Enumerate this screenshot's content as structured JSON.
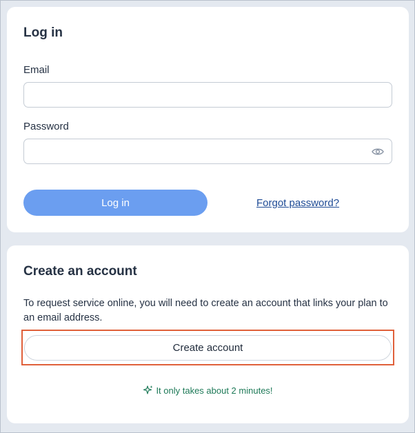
{
  "login": {
    "title": "Log in",
    "email_label": "Email",
    "email_value": "",
    "password_label": "Password",
    "password_value": "",
    "password_toggle_icon": "eye-icon",
    "login_button": "Log in",
    "forgot_link": "Forgot password?"
  },
  "create": {
    "title": "Create an account",
    "description": "To request service online, you will need to create an account that links your plan to an email address.",
    "button": "Create account",
    "note_icon": "sparkle-icon",
    "note": "It only takes about 2 minutes!"
  },
  "colors": {
    "login_button_bg": "#6b9ef0",
    "link": "#1d4a95",
    "highlight_border": "#e0603a",
    "note_text": "#1e7a58",
    "page_bg": "#e4e9f0"
  }
}
